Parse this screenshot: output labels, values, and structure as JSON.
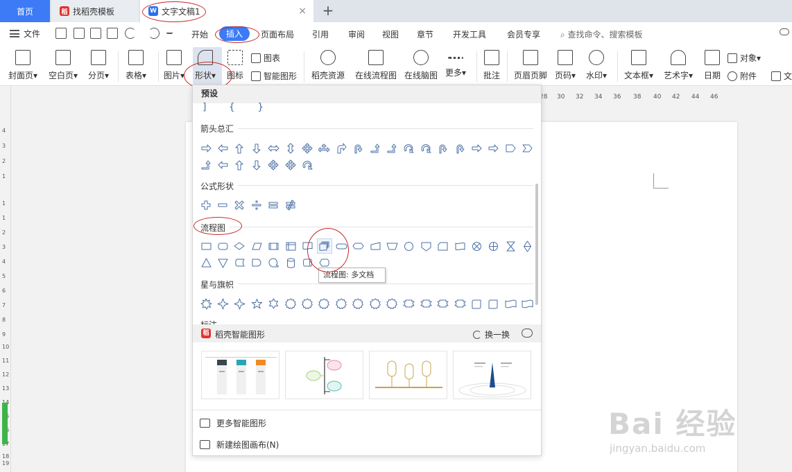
{
  "tabs": {
    "home": "首页",
    "template": "找稻壳模板",
    "doc": "文字文稿1",
    "close": "×",
    "add": "+"
  },
  "menubar": {
    "file": "文件",
    "items": [
      "开始",
      "插入",
      "页面布局",
      "引用",
      "审阅",
      "视图",
      "章节",
      "开发工具",
      "会员专享"
    ],
    "search": "查找命令、搜索模板"
  },
  "ribbon": {
    "cover": "封面页",
    "blank": "空白页",
    "pagebreak": "分页",
    "table": "表格",
    "picture": "图片",
    "shape": "形状",
    "icon": "图标",
    "chart": "图表",
    "smart_graphic": "智能图形",
    "daoke_resource": "稻壳资源",
    "flowchart": "在线流程图",
    "mindmap": "在线脑图",
    "more": "更多",
    "comment": "批注",
    "header_footer": "页眉页脚",
    "page_num": "页码",
    "watermark": "水印",
    "textbox": "文本框",
    "wordart": "艺术字",
    "date": "日期",
    "object": "对象",
    "attachment": "附件",
    "text_cut": "文"
  },
  "ruler": {
    "h_numbers": [
      "28",
      "30",
      "32",
      "34",
      "36",
      "38",
      "40",
      "42",
      "44",
      "46"
    ],
    "v_numbers": [
      "4",
      "3",
      "2",
      "1",
      "1",
      "1",
      "2",
      "3",
      "4",
      "5",
      "6",
      "7",
      "8",
      "9",
      "10",
      "11",
      "12",
      "13",
      "14",
      "15",
      "16",
      "17",
      "18",
      "19"
    ]
  },
  "dropdown": {
    "header": "预设",
    "braces": "] { }",
    "categories": {
      "arrows": "箭头总汇",
      "formula": "公式形状",
      "flowchart": "流程图",
      "stars": "星与旗帜",
      "callout_cut": "标注"
    },
    "tooltip": "流程图: 多文档",
    "smart": {
      "title": "稻壳智能图形",
      "refresh": "换一换"
    },
    "more_smart": "更多智能图形",
    "new_canvas": "新建绘图画布(N)"
  },
  "watermark": {
    "text": "Bai 经验",
    "url": "jingyan.baidu.com"
  }
}
